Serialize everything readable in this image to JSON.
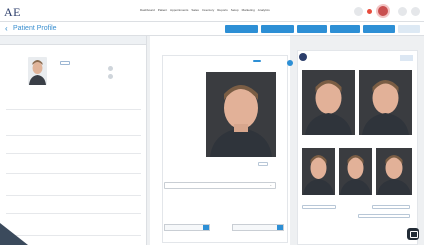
{
  "brand": {
    "logo": "AE",
    "sub": ""
  },
  "nav": [
    "Dashboard",
    "Patient",
    "Appointments",
    "Sales",
    "Inventory",
    "Reports",
    "Setup",
    "Marketing",
    "Analytics"
  ],
  "user": {
    "name": ""
  },
  "header": {
    "title": "Patient Profile",
    "actions": [
      "",
      "",
      "",
      "",
      "",
      ""
    ]
  },
  "left_panel": {
    "title": "",
    "patient": {
      "name": "",
      "line1": "",
      "line2": "",
      "badge": ""
    },
    "fields": [
      {
        "label": "",
        "value": ""
      },
      {
        "label": "",
        "value": ""
      },
      {
        "label": "",
        "value": ""
      },
      {
        "label": "",
        "value": ""
      },
      {
        "label": "",
        "value": ""
      },
      {
        "label": "",
        "value": ""
      },
      {
        "label": "",
        "value": ""
      }
    ]
  },
  "center": {
    "tabs": [
      "",
      ""
    ],
    "date": "",
    "chip": "",
    "section_label": "",
    "section_button": "",
    "select_value": "",
    "fields": [
      {
        "label": "",
        "value": ""
      },
      {
        "label": "",
        "value": ""
      }
    ],
    "bottom_buttons": [
      "",
      ""
    ]
  },
  "gallery": {
    "title": "",
    "subtitle": "",
    "edit": "",
    "buttons": [
      "",
      "",
      ""
    ]
  },
  "colors": {
    "accent": "#2d8fd5",
    "brand": "#2c3e6b",
    "avatar": "#c94f4f"
  }
}
